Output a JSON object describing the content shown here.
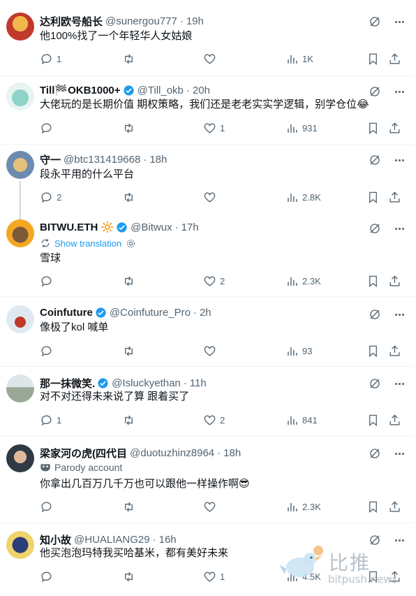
{
  "tweets": [
    {
      "name": "达利欧号船长",
      "handle": "@sunergou777",
      "time": "19h",
      "verified": false,
      "text": "他100%找了一个年轻华人女姑娘",
      "reply": "1",
      "retweet": "",
      "like": "",
      "views": "1K"
    },
    {
      "name": "Till🏁OKB1000+",
      "handle": "@Till_okb",
      "time": "20h",
      "verified": true,
      "text": "大佬玩的是长期价值 期权策略，我们还是老老实实学逻辑，别学仓位😂",
      "reply": "",
      "retweet": "",
      "like": "1",
      "views": "931"
    },
    {
      "name": "守一",
      "handle": "@btc131419668",
      "time": "18h",
      "verified": false,
      "text": "段永平用的什么平台",
      "reply": "2",
      "retweet": "",
      "like": "",
      "views": "2.8K"
    },
    {
      "name": "BITWU.ETH 🔆",
      "handle": "@Bitwux",
      "time": "17h",
      "verified": true,
      "translation": "Show translation",
      "text": "雪球",
      "reply": "",
      "retweet": "",
      "like": "2",
      "views": "2.3K"
    },
    {
      "name": "Coinfuture",
      "handle": "@Coinfuture_Pro",
      "time": "2h",
      "verified": true,
      "text": "像极了kol 喊单",
      "reply": "",
      "retweet": "",
      "like": "",
      "views": "93"
    },
    {
      "name": "那一抹微笑.",
      "handle": "@Isluckyethan",
      "time": "11h",
      "verified": true,
      "text": "对不对还得未来说了算 跟着买了",
      "reply": "1",
      "retweet": "",
      "like": "2",
      "views": "841"
    },
    {
      "name": "梁家河の虎(四代目",
      "handle": "@duotuzhinz8964",
      "time": "18h",
      "verified": false,
      "parody": "Parody account",
      "text": "你拿出几百万几千万也可以跟他一样操作啊😎",
      "reply": "",
      "retweet": "",
      "like": "",
      "views": "2.3K"
    },
    {
      "name": "知小故",
      "handle": "@HUALIANG29",
      "time": "16h",
      "verified": false,
      "text": "他买泡泡玛特我买哈基米，都有美好未来",
      "reply": "",
      "retweet": "",
      "like": "1",
      "views": "4.5K"
    }
  ],
  "watermark": {
    "cn": "比推",
    "en": "bitpush.news"
  },
  "colors": {
    "text": "#0f1419",
    "secondary": "#536471",
    "accent": "#1d9bf0",
    "border": "#eff3f4"
  }
}
